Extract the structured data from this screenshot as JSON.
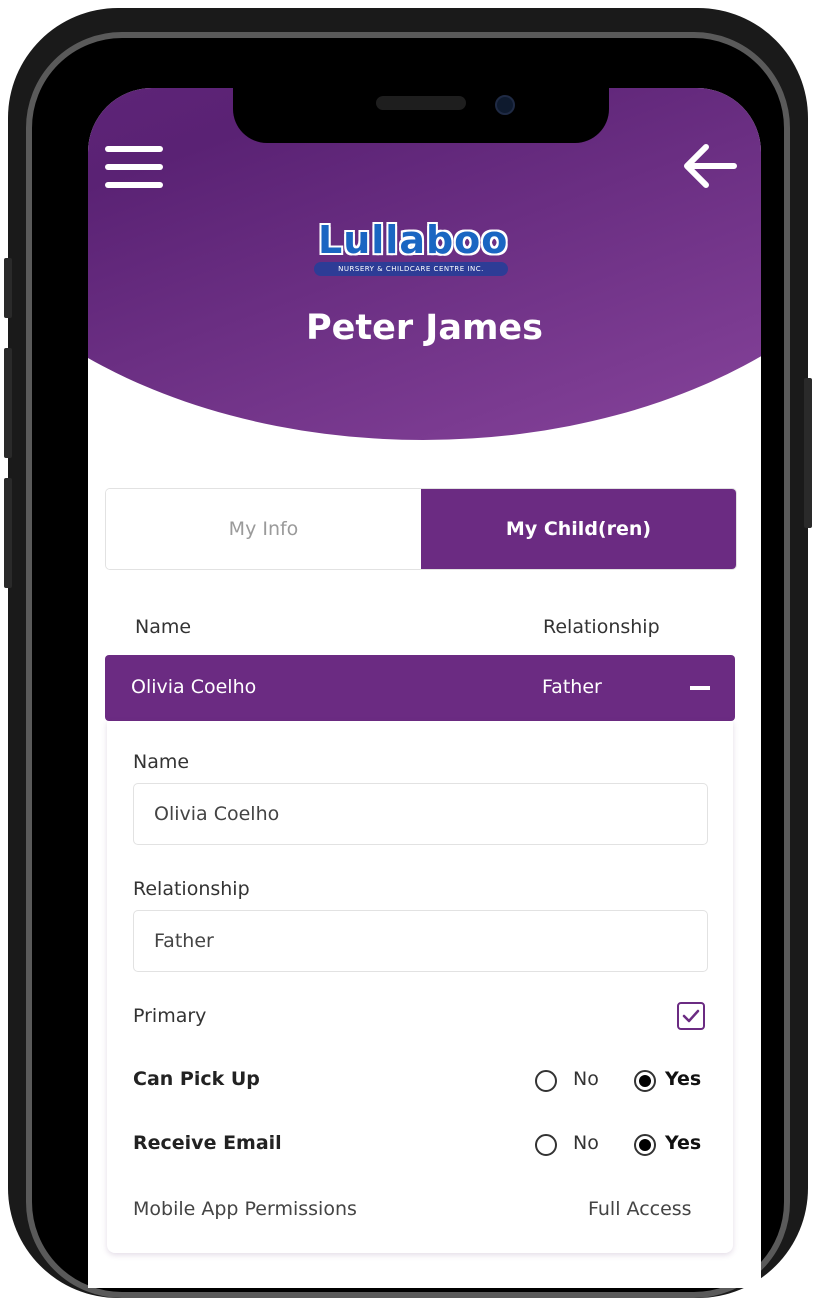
{
  "header": {
    "user_name": "Peter James",
    "logo_text": "Lullaboo",
    "logo_subtext": "NURSERY & CHILDCARE CENTRE INC."
  },
  "tabs": [
    {
      "label": "My Info",
      "active": false
    },
    {
      "label": "My Child(ren)",
      "active": true
    }
  ],
  "columns": {
    "name": "Name",
    "relationship": "Relationship"
  },
  "child": {
    "name": "Olivia Coelho",
    "relationship": "Father"
  },
  "form": {
    "name_label": "Name",
    "name_value": "Olivia Coelho",
    "relationship_label": "Relationship",
    "relationship_value": "Father",
    "primary_label": "Primary",
    "primary_checked": true,
    "can_pick_up": {
      "label": "Can Pick Up",
      "no": "No",
      "yes": "Yes",
      "selected": "Yes"
    },
    "receive_email": {
      "label": "Receive Email",
      "no": "No",
      "yes": "Yes",
      "selected": "Yes"
    },
    "permissions_label": "Mobile App Permissions",
    "permissions_value": "Full Access"
  },
  "colors": {
    "primary": "#6b2b82",
    "header_light": "#8b479f"
  },
  "icons": [
    "hamburger-menu-icon",
    "back-arrow-icon",
    "minus-icon",
    "checkmark-icon"
  ]
}
